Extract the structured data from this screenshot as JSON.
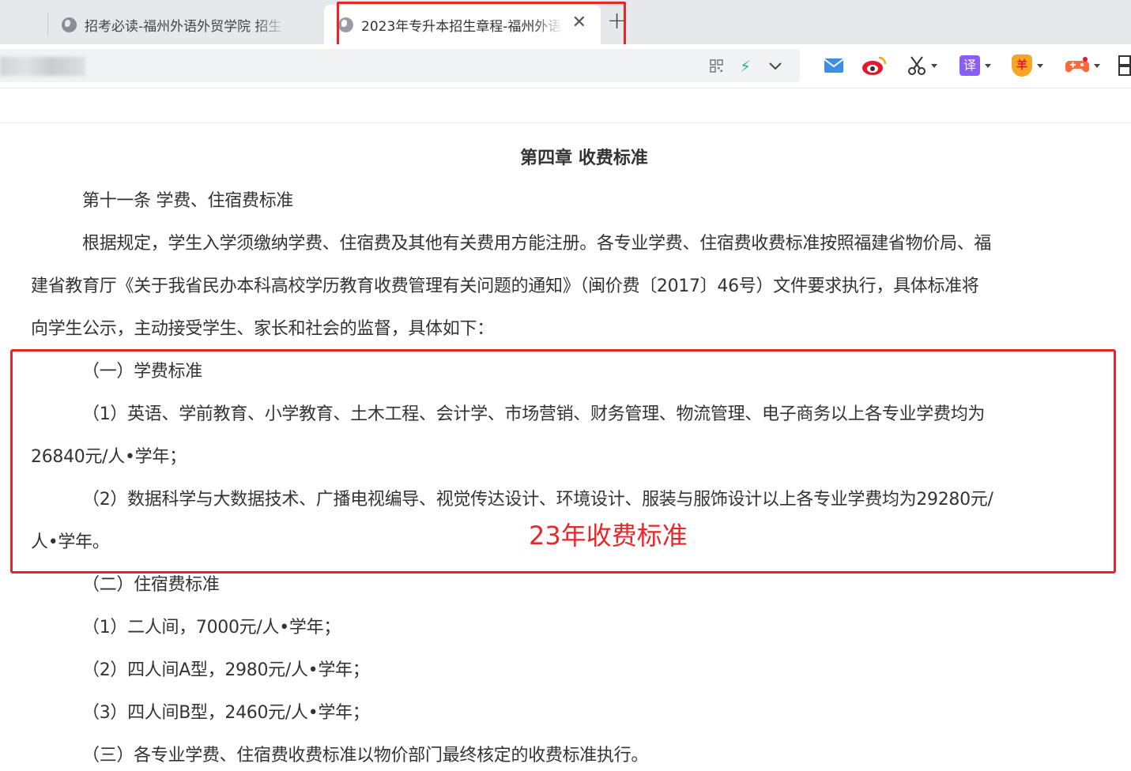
{
  "tabs": [
    {
      "title": "招考必读-福州外语外贸学院 招生",
      "active": false
    },
    {
      "title": "2023年专升本招生章程-福州外语",
      "active": true
    }
  ],
  "tab_close_glyph": "✕",
  "new_tab_glyph": "+",
  "address_bar": {
    "url": ""
  },
  "toolbar_icons": [
    "qr-code-icon",
    "lightning-icon",
    "chevron-down-icon",
    "mail-icon",
    "weibo-icon",
    "scissors-icon",
    "translate-icon",
    "shield-coin-icon",
    "gamepad-icon",
    "sidebar-icon"
  ],
  "translate_glyph": "译",
  "coin_glyph": "羊",
  "document": {
    "chapter_title": "第四章  收费标准",
    "article_heading": "第十一条 学费、住宿费标准",
    "intro_lines": [
      "根据规定，学生入学须缴纳学费、住宿费及其他有关费用方能注册。各专业学费、住宿费收费标准按照福建省物价局、福",
      "建省教育厅《关于我省民办本科高校学历教育收费管理有关问题的通知》（闽价费〔2017〕46号）文件要求执行，具体标准将",
      "向学生公示，主动接受学生、家长和社会的监督，具体如下："
    ],
    "tuition_heading": "（一）学费标准",
    "tuition_item1_lines": [
      "（1）英语、学前教育、小学教育、土木工程、会计学、市场营销、财务管理、物流管理、电子商务以上各专业学费均为",
      "26840元/人•学年；"
    ],
    "tuition_item2_lines": [
      "（2）数据科学与大数据技术、广播电视编导、视觉传达设计、环境设计、服装与服饰设计以上各专业学费均为29280元/",
      "人•学年。"
    ],
    "dorm_heading": "（二）住宿费标准",
    "dorm_items": [
      "（1）二人间，7000元/人•学年；",
      "（2）四人间A型，2980元/人•学年；",
      "（3）四人间B型，2460元/人•学年；"
    ],
    "final_clause": "（三）各专业学费、住宿费收费标准以物价部门最终核定的收费标准执行。"
  },
  "annotation": {
    "text": "23年收费标准",
    "color": "#e8262a"
  },
  "colors": {
    "highlight_red": "#e8262a",
    "tabstrip_bg": "#e6e8ec",
    "body_text": "#333333"
  }
}
